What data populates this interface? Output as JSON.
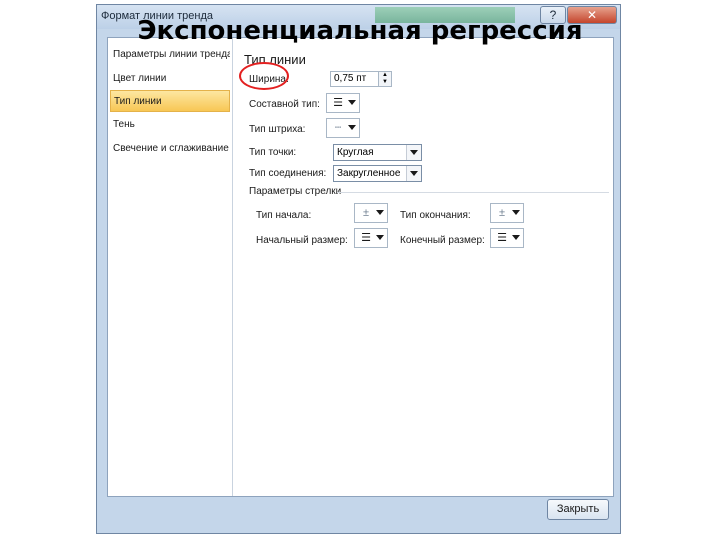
{
  "slide": {
    "title": "Экспоненциальная регрессия"
  },
  "window": {
    "title": "Формат линии тренда",
    "help_label": "?",
    "close_label": "✕"
  },
  "nav": {
    "items": [
      {
        "label": "Параметры линии тренда"
      },
      {
        "label": "Цвет линии"
      },
      {
        "label": "Тип линии"
      },
      {
        "label": "Тень"
      },
      {
        "label": "Свечение и сглаживание"
      }
    ],
    "selected_index": 2
  },
  "panel": {
    "section_title": "Тип линии",
    "width_label": "Ширина:",
    "width_value": "0,75 пт",
    "compound_label": "Составной тип:",
    "dash_label": "Тип штриха:",
    "cap_label": "Тип точки:",
    "cap_value": "Круглая",
    "join_label": "Тип соединения:",
    "join_value": "Закругленное",
    "arrow_section": "Параметры стрелки",
    "begin_type_label": "Тип начала:",
    "end_type_label": "Тип окончания:",
    "begin_size_label": "Начальный размер:",
    "end_size_label": "Конечный размер:"
  },
  "footer": {
    "close_button": "Закрыть"
  },
  "colors": {
    "window_frame": "#c4d6ea",
    "selected_item": "#f8c755",
    "highlight_circle": "#e32020"
  }
}
